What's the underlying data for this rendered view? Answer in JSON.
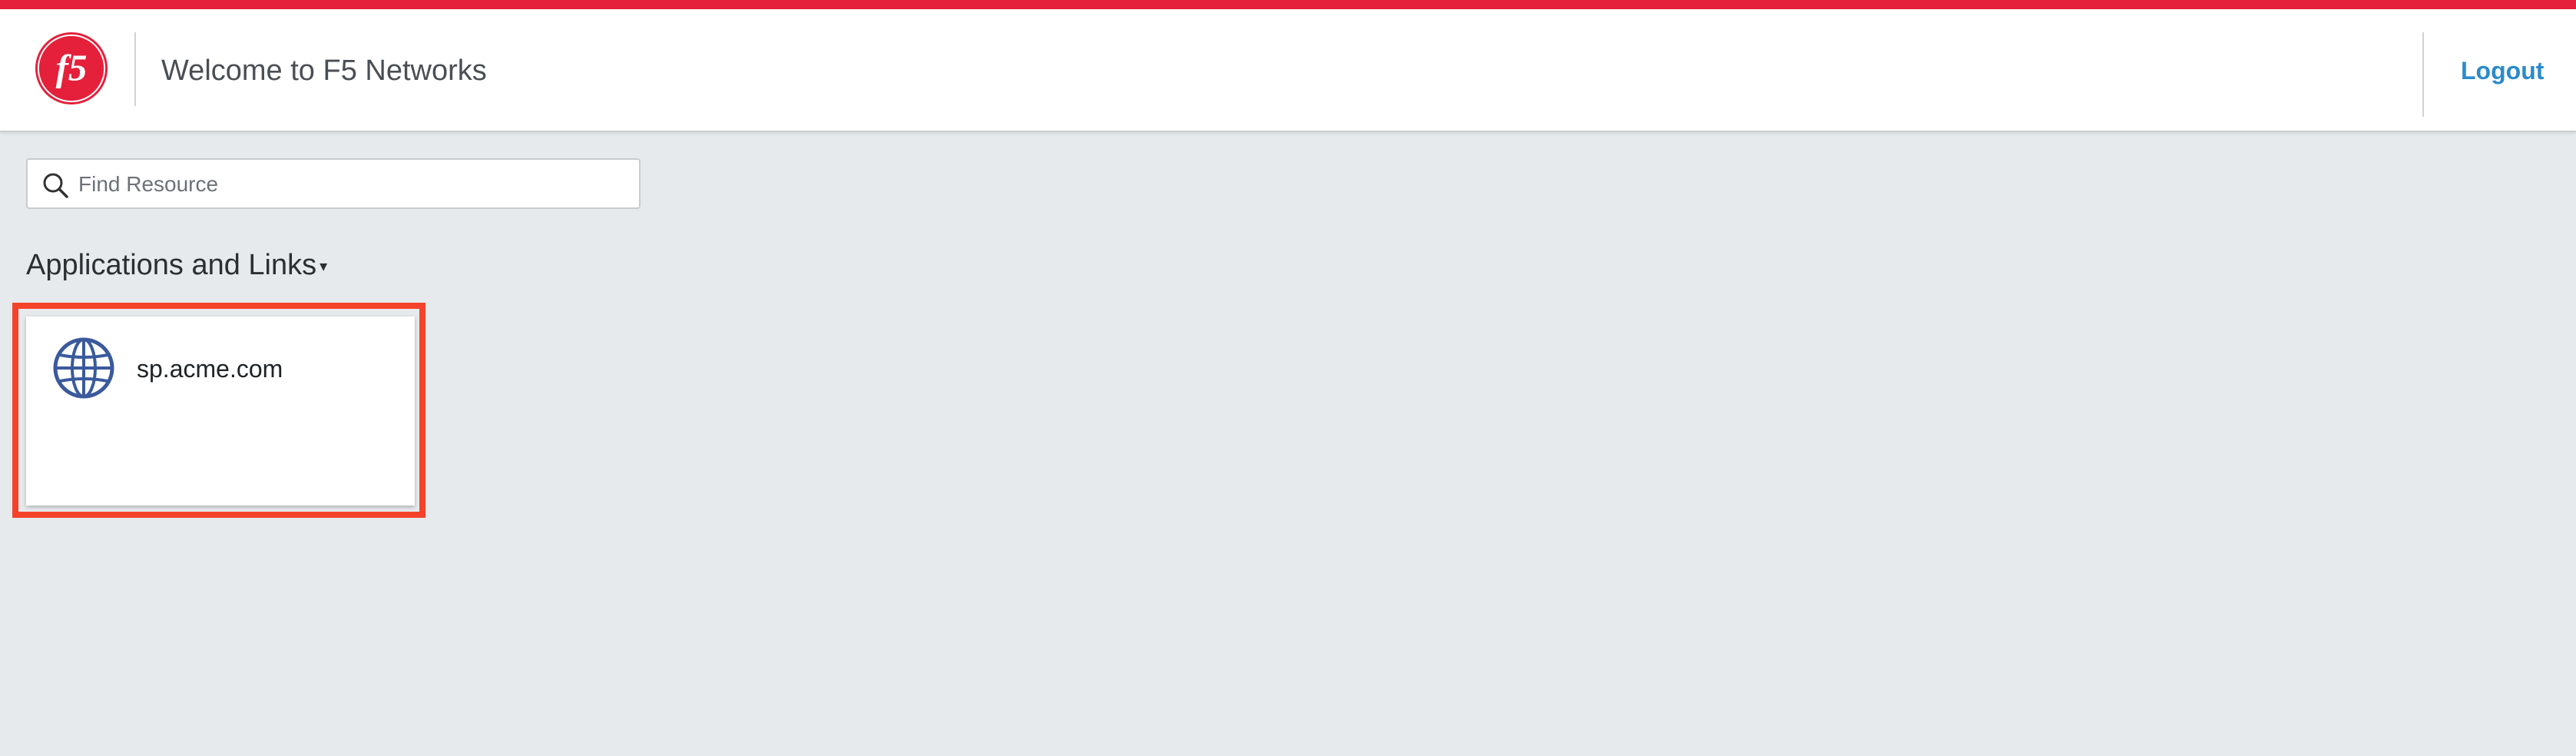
{
  "header": {
    "title": "Welcome to F5 Networks",
    "logout_label": "Logout",
    "logo_icon": "f5-logo-icon"
  },
  "search": {
    "placeholder": "Find Resource",
    "value": "",
    "icon": "search-icon"
  },
  "section": {
    "heading": "Applications and Links",
    "caret": "▾"
  },
  "apps": [
    {
      "label": "sp.acme.com",
      "icon": "globe-icon"
    }
  ],
  "colors": {
    "accent_bar": "#e4203a",
    "link": "#2b8acb",
    "background": "#e6eaed",
    "highlight": "#f4432a",
    "globe": "#3a5a9c"
  }
}
